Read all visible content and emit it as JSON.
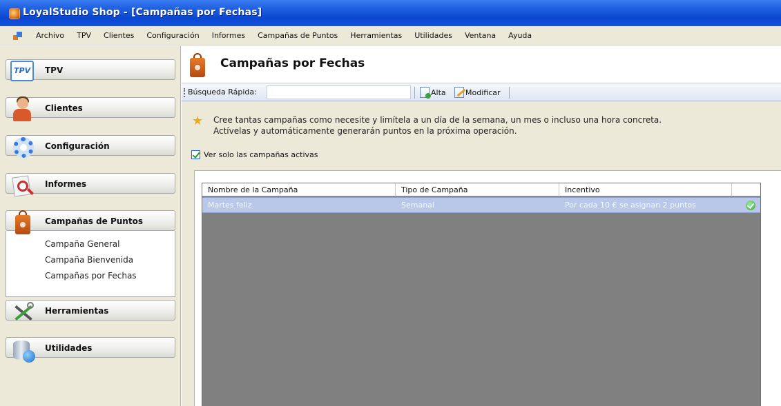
{
  "window": {
    "title": "LoyalStudio Shop - [Campañas por Fechas]"
  },
  "menubar": {
    "items": [
      "Archivo",
      "TPV",
      "Clientes",
      "Configuración",
      "Informes",
      "Campañas de Puntos",
      "Herramientas",
      "Utilidades",
      "Ventana",
      "Ayuda"
    ]
  },
  "sidebar": {
    "sections": [
      {
        "label": "TPV",
        "icon": "tpv-icon"
      },
      {
        "label": "Clientes",
        "icon": "person-icon"
      },
      {
        "label": "Configuración",
        "icon": "gear-icon"
      },
      {
        "label": "Informes",
        "icon": "search-report-icon"
      },
      {
        "label": "Campañas de Puntos",
        "icon": "shopping-bag-icon",
        "expanded": true,
        "items": [
          "Campaña General",
          "Campaña Bienvenida",
          "Campañas por Fechas"
        ]
      },
      {
        "label": "Herramientas",
        "icon": "tools-icon"
      },
      {
        "label": "Utilidades",
        "icon": "database-icon"
      }
    ]
  },
  "main": {
    "title": "Campañas por Fechas",
    "toolbar": {
      "search_label": "Búsqueda Rápida:",
      "search_value": "",
      "add_label": "Alta",
      "edit_label": "Modificar"
    },
    "info": {
      "line1": "Cree tantas campañas como necesite y limítela a un día de la semana, un mes o incluso una hora concreta.",
      "line2": "Actívelas y automáticamente generarán puntos en la próxima operación."
    },
    "filter": {
      "label": "Ver solo las campañas activas",
      "checked": true
    },
    "table": {
      "columns": [
        "Nombre de la Campaña",
        "Tipo de Campaña",
        "Incentivo"
      ],
      "rows": [
        {
          "name": "Martes feliz",
          "type": "Semanal",
          "incentive": "Por cada 10 € se asignan 2 puntos",
          "active": true
        }
      ]
    }
  },
  "colors": {
    "titlebar": "#0b47d1",
    "selected_row": "#b9c8e8",
    "grid_background": "#808080",
    "accent_orange": "#e07a24"
  }
}
